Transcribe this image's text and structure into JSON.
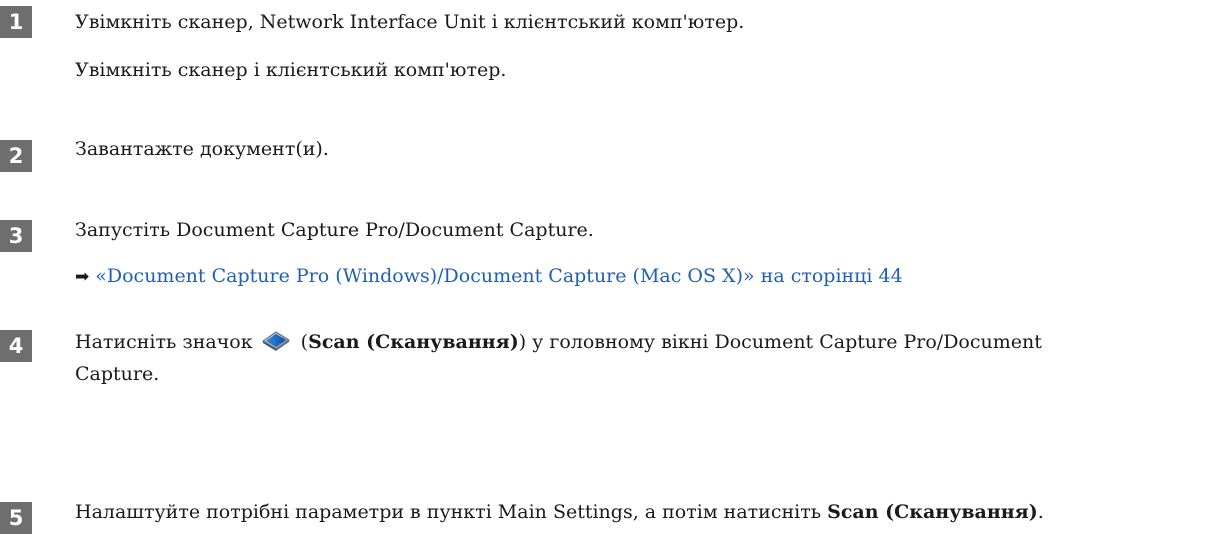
{
  "steps": [
    {
      "number": "1",
      "text": "Увімкніть сканер, Network Interface Unit і клієнтський комп'ютер.",
      "sub": "Увімкніть сканер і клієнтський комп'ютер."
    },
    {
      "number": "2",
      "text": "Завантажте документ(и)."
    },
    {
      "number": "3",
      "text": "Запустіть Document Capture Pro/Document Capture.",
      "link": "«Document Capture Pro (Windows)/Document Capture (Mac OS X)» на сторінці 44"
    },
    {
      "number": "4",
      "text_before": "Натисніть значок",
      "paren_open": "(",
      "bold": "Scan (Сканування)",
      "text_after": ") у головному вікні Document Capture Pro/Document",
      "text_wrap": "Capture."
    },
    {
      "number": "5",
      "text_before": "Налаштуйте потрібні параметри в пункті Main Settings, а потім натисніть ",
      "bold": "Scan (Сканування)",
      "text_after": "."
    }
  ],
  "icons": {
    "link_arrow": "right-arrow-icon",
    "scan": "scan-icon"
  },
  "colors": {
    "badge": "#6e6e6e",
    "link": "#1f5fb5"
  }
}
